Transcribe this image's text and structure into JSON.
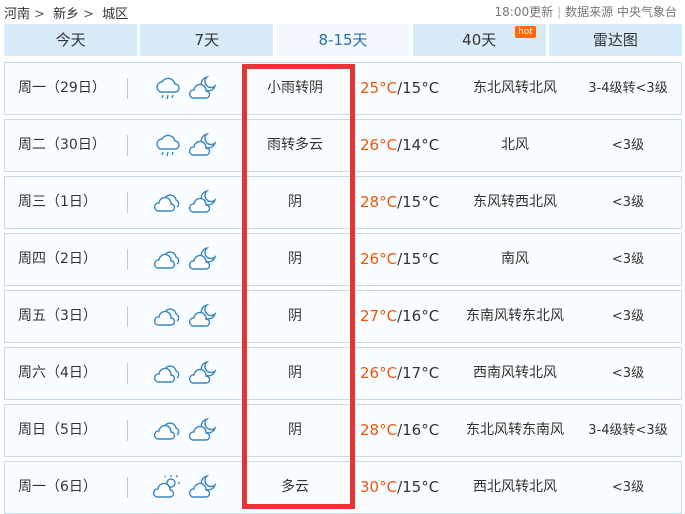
{
  "breadcrumb": [
    "河南",
    "新乡",
    "城区"
  ],
  "breadcrumb_sep": ">",
  "update_time": "18:00更新",
  "source_label": "数据来源 中央气象台",
  "tabs": [
    {
      "label": "今天",
      "active": false
    },
    {
      "label": "7天",
      "active": false
    },
    {
      "label": "8-15天",
      "active": true
    },
    {
      "label": "40天",
      "active": false,
      "badge": "hot"
    },
    {
      "label": "雷达图",
      "active": false
    }
  ],
  "colors": {
    "tab_bg": "#d8ebf8",
    "tab_active_bg": "#f2f8fd",
    "high_temp": "#e8570d",
    "highlight_box": "#e53434",
    "hot_badge": "#ff6a00",
    "icon_stroke": "#3a87c2"
  },
  "rows": [
    {
      "day": "周一（29日）",
      "icons": [
        "rain-cloud-icon",
        "moon-cloud-icon"
      ],
      "weather": "小雨转阴",
      "high": "25°C",
      "low": "/15°C",
      "wind": "东北风转北风",
      "level": "3-4级转<3级"
    },
    {
      "day": "周二（30日）",
      "icons": [
        "rain-cloud-icon",
        "moon-cloud-icon"
      ],
      "weather": "雨转多云",
      "high": "26°C",
      "low": "/14°C",
      "wind": "北风",
      "level": "<3级"
    },
    {
      "day": "周三（1日）",
      "icons": [
        "overcast-icon",
        "moon-cloud-icon"
      ],
      "weather": "阴",
      "high": "28°C",
      "low": "/15°C",
      "wind": "东风转西北风",
      "level": "<3级"
    },
    {
      "day": "周四（2日）",
      "icons": [
        "overcast-icon",
        "moon-cloud-icon"
      ],
      "weather": "阴",
      "high": "26°C",
      "low": "/15°C",
      "wind": "南风",
      "level": "<3级"
    },
    {
      "day": "周五（3日）",
      "icons": [
        "overcast-icon",
        "moon-cloud-icon"
      ],
      "weather": "阴",
      "high": "27°C",
      "low": "/16°C",
      "wind": "东南风转东北风",
      "level": "<3级"
    },
    {
      "day": "周六（4日）",
      "icons": [
        "overcast-icon",
        "moon-cloud-icon"
      ],
      "weather": "阴",
      "high": "26°C",
      "low": "/17°C",
      "wind": "西南风转北风",
      "level": "<3级"
    },
    {
      "day": "周日（5日）",
      "icons": [
        "overcast-icon",
        "moon-cloud-icon"
      ],
      "weather": "阴",
      "high": "28°C",
      "low": "/16°C",
      "wind": "东北风转东南风",
      "level": "3-4级转<3级"
    },
    {
      "day": "周一（6日）",
      "icons": [
        "sun-cloud-icon",
        "moon-cloud-icon"
      ],
      "weather": "多云",
      "high": "30°C",
      "low": "/15°C",
      "wind": "西北风转北风",
      "level": "<3级"
    }
  ]
}
